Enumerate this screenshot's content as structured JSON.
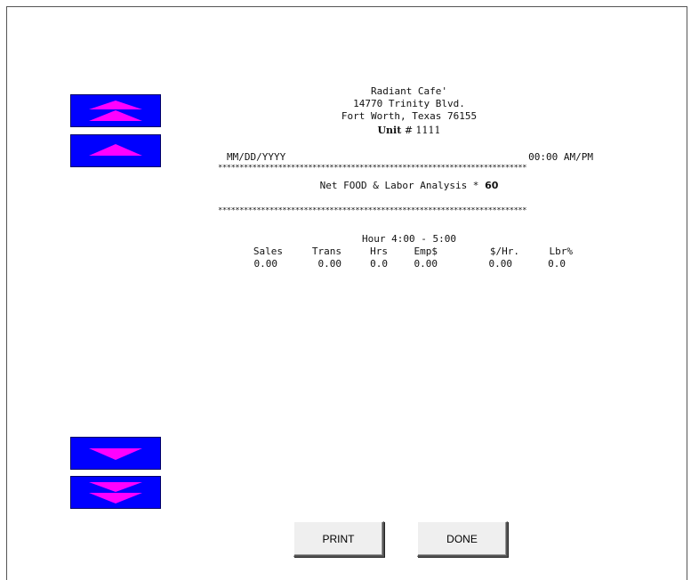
{
  "header": {
    "store_name": "Radiant Cafe'",
    "address_line": "14770 Trinity Blvd.",
    "city_line": "Fort Worth, Texas 76155",
    "unit_label": "Unit",
    "unit_number": "# 1111"
  },
  "meta": {
    "date": "MM/DD/YYYY",
    "time": "00:00 AM/PM"
  },
  "report": {
    "title_prefix": "Net FOOD & Labor Analysis * ",
    "title_number": "60",
    "hour_range": "Hour 4:00 - 5:00",
    "stars": "************************************************************************"
  },
  "table": {
    "headers": [
      "Sales",
      "Trans",
      "Hrs",
      "Emp$",
      "$/Hr.",
      "Lbr%"
    ],
    "values": [
      "0.00",
      "0.00",
      "0.0",
      "0.00",
      "0.00",
      "0.0"
    ]
  },
  "scroll": {
    "page_up_icon": "double-up-arrow",
    "line_up_icon": "single-up-arrow",
    "line_down_icon": "single-down-arrow",
    "page_down_icon": "double-down-arrow",
    "button_color": "#0000ff",
    "arrow_color": "#ff00ff"
  },
  "buttons": {
    "print_label": "PRINT",
    "done_label": "DONE"
  }
}
